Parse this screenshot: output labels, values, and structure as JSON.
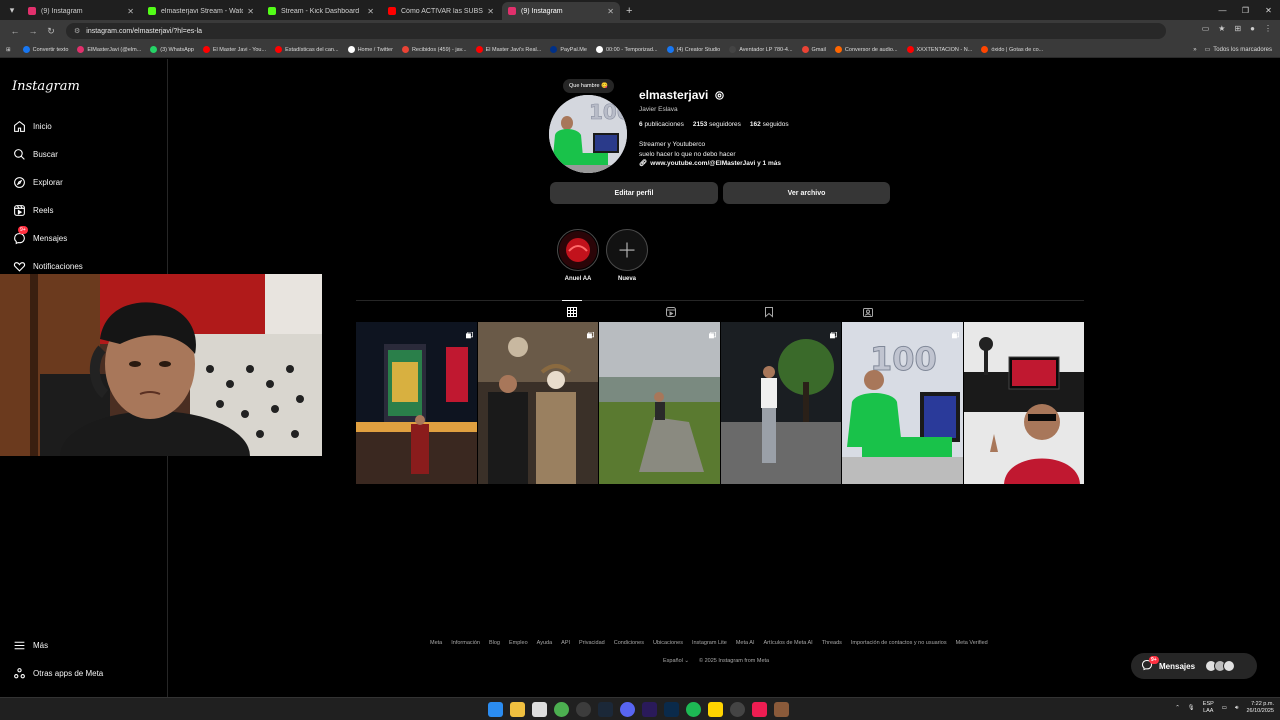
{
  "browser": {
    "tabs": [
      {
        "title": "(9) Instagram",
        "color": "#e1306c",
        "active": false
      },
      {
        "title": "elmasterjavi Stream - Watch Li...",
        "color": "#53fc18",
        "active": false
      },
      {
        "title": "Stream - Kick Dashboard",
        "color": "#53fc18",
        "active": false
      },
      {
        "title": "Cómo ACTIVAR las SUBS en...",
        "color": "#ff0000",
        "active": false
      },
      {
        "title": "(9) Instagram",
        "color": "#e1306c",
        "active": true
      }
    ],
    "url": "instagram.com/elmasterjavi/?hl=es-la",
    "bookmarks": [
      {
        "label": "Convertir texto",
        "color": "#1877f2"
      },
      {
        "label": "ElMasterJavi (@elm...",
        "color": "#e1306c"
      },
      {
        "label": "(3) WhatsApp",
        "color": "#25d366"
      },
      {
        "label": "El Master Javi - You...",
        "color": "#ff0000"
      },
      {
        "label": "Estadísticas del can...",
        "color": "#ff0000"
      },
      {
        "label": "Home / Twitter",
        "color": "#ffffff"
      },
      {
        "label": "Recibidos (459) - jav...",
        "color": "#ea4335"
      },
      {
        "label": "El Master Javi's Real...",
        "color": "#ff0000"
      },
      {
        "label": "PayPal.Me",
        "color": "#003087"
      },
      {
        "label": "00:00 - Temporizad...",
        "color": "#ffffff"
      },
      {
        "label": "(4) Creator Studio",
        "color": "#1877f2"
      },
      {
        "label": "Aventador LP 780-4...",
        "color": "#444444"
      },
      {
        "label": "Gmail",
        "color": "#ea4335"
      },
      {
        "label": "Conversor de audio...",
        "color": "#ff6600"
      },
      {
        "label": "XXXTENTACION - N...",
        "color": "#ff0000"
      },
      {
        "label": "óxido | Gotas de co...",
        "color": "#ff4500"
      }
    ],
    "all_bookmarks": "Todos los marcadores"
  },
  "sidebar": {
    "logo": "Instagram",
    "items": [
      {
        "label": "Inicio",
        "icon": "home-icon"
      },
      {
        "label": "Buscar",
        "icon": "search-icon"
      },
      {
        "label": "Explorar",
        "icon": "compass-icon"
      },
      {
        "label": "Reels",
        "icon": "reels-icon"
      },
      {
        "label": "Mensajes",
        "icon": "messenger-icon",
        "badge": "9+"
      },
      {
        "label": "Notificaciones",
        "icon": "heart-icon"
      }
    ],
    "more": "Más",
    "meta_apps": "Otras apps de Meta"
  },
  "profile": {
    "note": "Que hambre 😋",
    "username": "elmasterjavi",
    "full_name": "Javier Eslava",
    "posts": "6",
    "posts_label": "publicaciones",
    "followers": "2153",
    "followers_label": "seguidores",
    "following": "162",
    "following_label": "seguidos",
    "bio_line1": "Streamer y Youtuberco",
    "bio_line2": "suelo hacer lo que no debo hacer",
    "bio_link": "www.youtube.com/@ElMasterJavi y 1 más",
    "edit_button": "Editar perfil",
    "archive_button": "Ver archivo"
  },
  "highlights": [
    {
      "label": "Anuel AA"
    },
    {
      "label": "Nueva"
    }
  ],
  "posts_grid": [
    {
      "scene": "night billboard street",
      "multi": true
    },
    {
      "scene": "store mannequin",
      "multi": true
    },
    {
      "scene": "hill rock",
      "multi": true
    },
    {
      "scene": "night tree",
      "multi": true
    },
    {
      "scene": "green tracksuit balloons",
      "multi": true
    },
    {
      "scene": "setup sunglasses",
      "multi": false
    }
  ],
  "footer": {
    "links": [
      "Meta",
      "Información",
      "Blog",
      "Empleo",
      "Ayuda",
      "API",
      "Privacidad",
      "Condiciones",
      "Ubicaciones",
      "Instagram Lite",
      "Meta AI",
      "Artículos de Meta AI",
      "Threads",
      "Importación de contactos y no usuarios",
      "Meta Verified"
    ],
    "language": "Español",
    "copyright": "© 2025 Instagram from Meta"
  },
  "messages_pill": {
    "label": "Mensajes",
    "badge": "9+"
  },
  "taskbar": {
    "lang_top": "ESP",
    "lang_bottom": "LAA",
    "time": "7:22 p.m.",
    "date": "26/10/2025"
  }
}
